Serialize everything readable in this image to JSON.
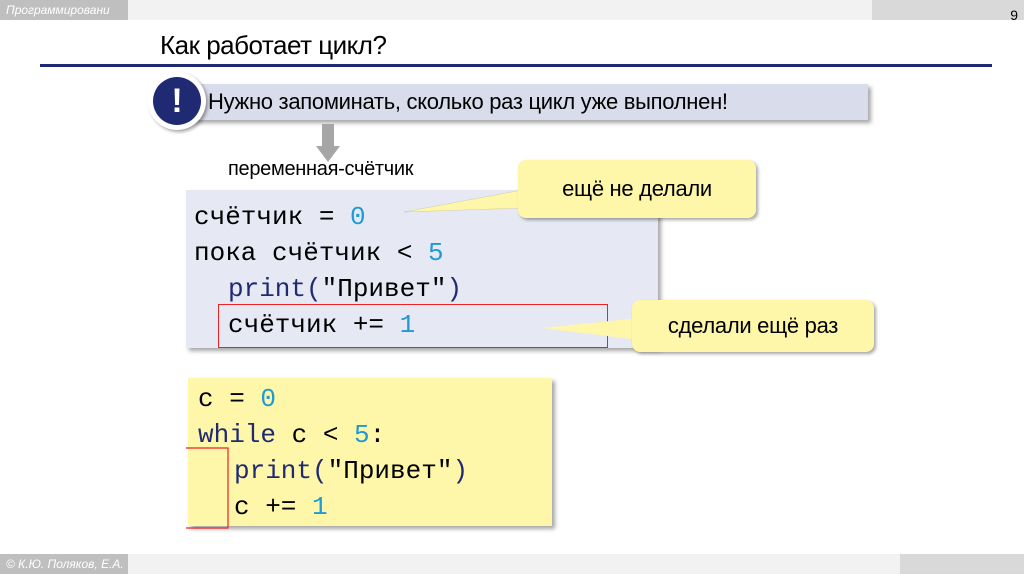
{
  "header": {
    "course": "Программировани",
    "page_number": "9"
  },
  "title": "Как работает цикл?",
  "note": {
    "icon": "!",
    "text": "Нужно запоминать, сколько раз цикл уже выполнен!"
  },
  "variable_label": "переменная-счётчик",
  "pseudocode": {
    "line1_var": "счётчик = ",
    "line1_num": "0",
    "line2_kw": "пока счётчик < ",
    "line2_num": "5",
    "line3_fn": "print(",
    "line3_str": "\"Привет\"",
    "line3_close": ")",
    "line4_var": "счётчик += ",
    "line4_num": "1"
  },
  "bubbles": {
    "not_done": "ещё не делали",
    "done_again": "сделали ещё раз"
  },
  "python_code": {
    "line1_var": "c = ",
    "line1_num": "0",
    "line2_kw": "while",
    "line2_rest": " c < ",
    "line2_num": "5",
    "line2_colon": ":",
    "line3_fn": "print(",
    "line3_str": "\"Привет\"",
    "line3_close": ")",
    "line4_var": "c += ",
    "line4_num": "1"
  },
  "footer": {
    "author": "© К.Ю. Поляков, Е.А."
  },
  "colors": {
    "accent": "#1f2a73",
    "number": "#1e9ad6",
    "bubble": "#fef6a8",
    "code_bg": "#e6e9f4"
  }
}
